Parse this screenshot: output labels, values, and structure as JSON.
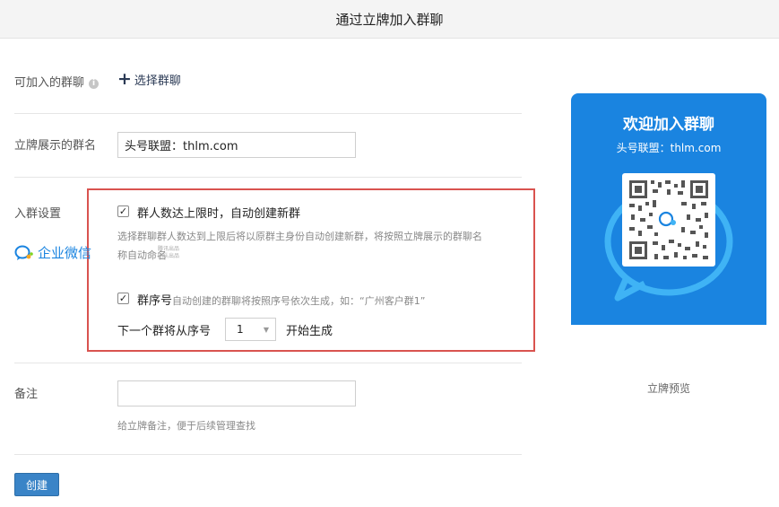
{
  "header": {
    "title": "通过立牌加入群聊"
  },
  "form": {
    "joinable_groups": {
      "label": "可加入的群聊",
      "action": "选择群聊"
    },
    "display_name": {
      "label": "立牌展示的群名",
      "value": "头号联盟：thlm.com"
    },
    "settings": {
      "label": "入群设置",
      "auto_create": {
        "checked": true,
        "title": "群人数达上限时，自动创建新群",
        "hint_line1": "选择群聊群人数达到上限后将以原群主身份自动创建新群，将按照立牌展示的群聊名",
        "hint_line2": "称自动命名"
      },
      "serial": {
        "checked": true,
        "title": "群序号",
        "hint": "自动创建的群聊将按照序号依次生成，如：“广州客户群1”",
        "next_prefix": "下一个群将从序号",
        "next_value": "1",
        "next_suffix": "开始生成"
      }
    },
    "remark": {
      "label": "备注",
      "value": "",
      "hint": "给立牌备注，便于后续管理查找"
    },
    "create_button": "创建"
  },
  "preview": {
    "title": "欢迎加入群聊",
    "subtitle": "头号联盟：thlm.com",
    "brand": "企业微信",
    "brand_small_1": "腾讯出品",
    "brand_small_2": "团队出品",
    "label": "立牌预览",
    "colors": {
      "card_blue": "#1a84e0",
      "bubble": "#3fb3f5"
    }
  },
  "colors": {
    "highlight_border": "#d9534f",
    "button": "#3a84c7"
  }
}
